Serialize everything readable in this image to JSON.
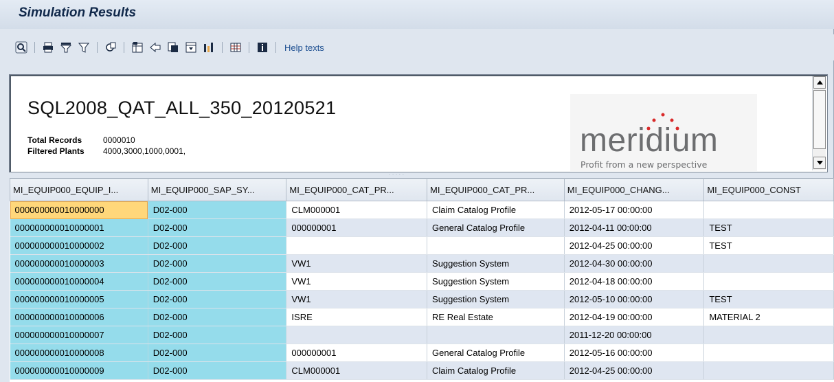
{
  "window": {
    "title": "Simulation Results"
  },
  "toolbar": {
    "buttons": [
      {
        "icon": "details-icon"
      },
      {
        "icon": "print-icon"
      },
      {
        "icon": "set-filter-icon"
      },
      {
        "icon": "filter-icon"
      },
      {
        "icon": "export-icon"
      },
      {
        "icon": "spreadsheet-icon"
      },
      {
        "icon": "send-icon"
      },
      {
        "icon": "layout-icon"
      },
      {
        "icon": "choose-layout-icon"
      },
      {
        "icon": "graphic-icon"
      },
      {
        "icon": "grid-icon"
      },
      {
        "icon": "info-icon"
      }
    ],
    "help_label": "Help texts"
  },
  "header": {
    "report_title": "SQL2008_QAT_ALL_350_20120521",
    "total_records_label": "Total Records",
    "total_records_value": "0000010",
    "filtered_plants_label": "Filtered Plants",
    "filtered_plants_value": "4000,3000,1000,0001,",
    "logo_word": "meridium",
    "logo_tagline": "Profit from a new perspective"
  },
  "grid": {
    "columns": [
      "MI_EQUIP000_EQUIP_I...",
      "MI_EQUIP000_SAP_SY...",
      "MI_EQUIP000_CAT_PR...",
      "MI_EQUIP000_CAT_PR...",
      "MI_EQUIP000_CHANG...",
      "MI_EQUIP000_CONST"
    ],
    "rows": [
      [
        "000000000010000000",
        "D02-000",
        "CLM000001",
        "Claim Catalog Profile",
        "2012-05-17 00:00:00",
        ""
      ],
      [
        "000000000010000001",
        "D02-000",
        "000000001",
        "General Catalog Profile",
        "2012-04-11 00:00:00",
        "TEST"
      ],
      [
        "000000000010000002",
        "D02-000",
        "",
        "",
        "2012-04-25 00:00:00",
        "TEST"
      ],
      [
        "000000000010000003",
        "D02-000",
        "VW1",
        "Suggestion System",
        "2012-04-30 00:00:00",
        ""
      ],
      [
        "000000000010000004",
        "D02-000",
        "VW1",
        "Suggestion System",
        "2012-04-18 00:00:00",
        ""
      ],
      [
        "000000000010000005",
        "D02-000",
        "VW1",
        "Suggestion System",
        "2012-05-10 00:00:00",
        "TEST"
      ],
      [
        "000000000010000006",
        "D02-000",
        "ISRE",
        "RE Real Estate",
        "2012-04-19 00:00:00",
        "MATERIAL 2"
      ],
      [
        "000000000010000007",
        "D02-000",
        "",
        "",
        "2011-12-20 00:00:00",
        ""
      ],
      [
        "000000000010000008",
        "D02-000",
        "000000001",
        "General Catalog Profile",
        "2012-05-16 00:00:00",
        ""
      ],
      [
        "000000000010000009",
        "D02-000",
        "CLM000001",
        "Claim Catalog Profile",
        "2012-04-25 00:00:00",
        ""
      ]
    ]
  }
}
